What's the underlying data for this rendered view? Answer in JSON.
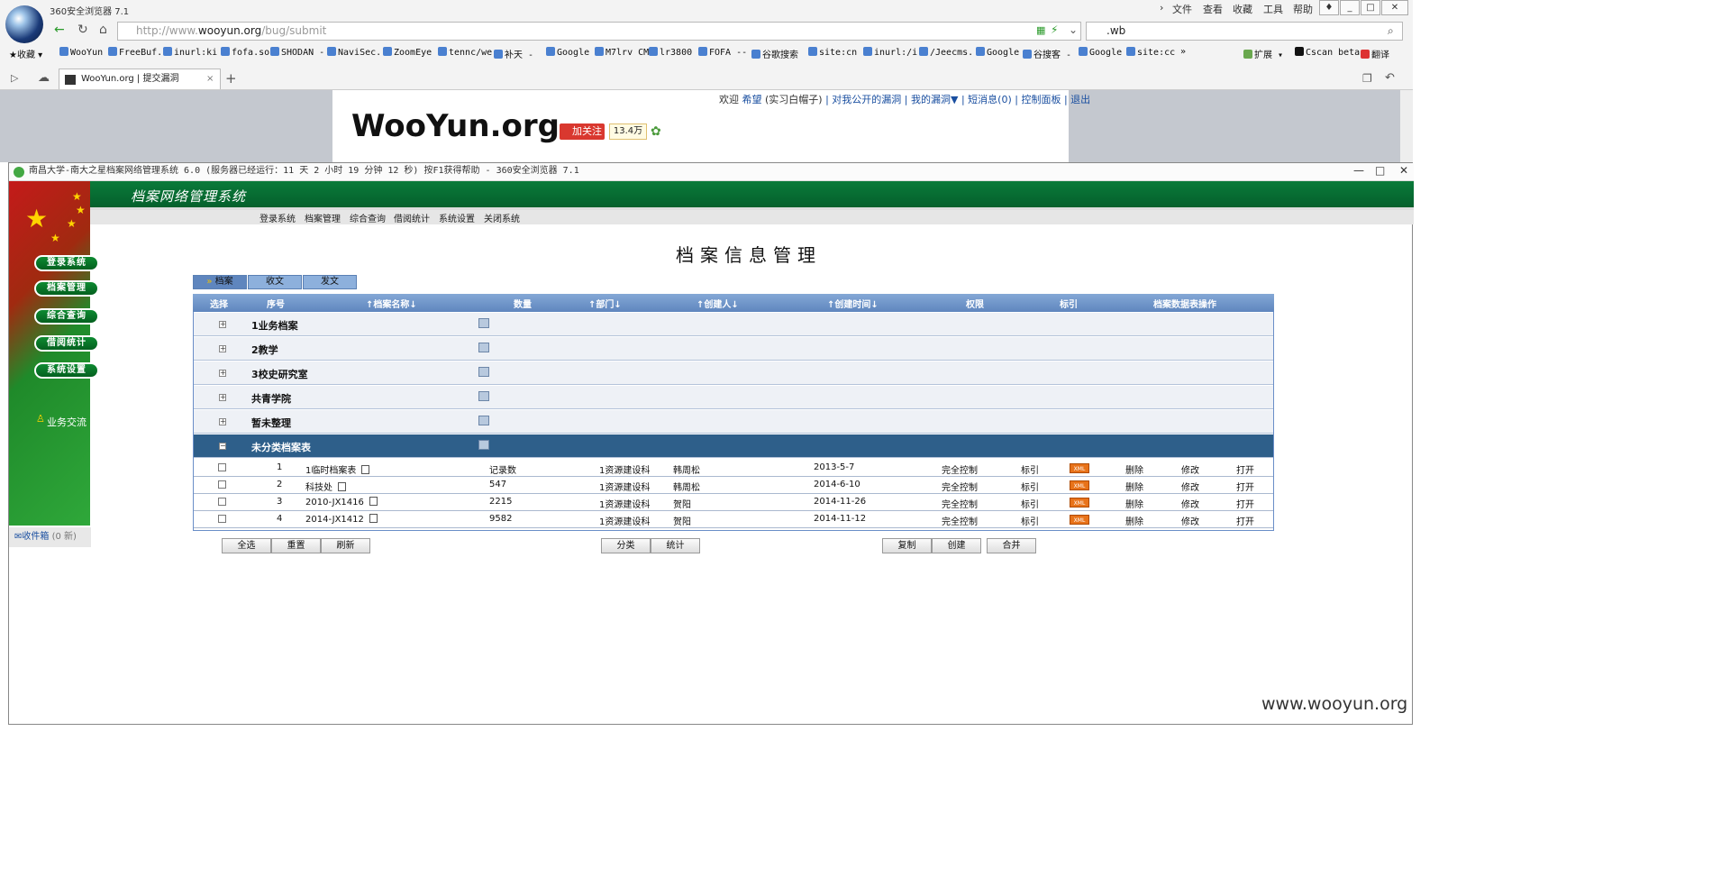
{
  "browser": {
    "title": "360安全浏览器 7.1",
    "menu": [
      "文件",
      "查看",
      "收藏",
      "工具",
      "帮助"
    ],
    "address": {
      "prefix": "http://www.",
      "domain": "wooyun.org",
      "path": "/bug/submit"
    },
    "search_value": ".wb",
    "bookmarks_label": "收藏",
    "bookmarks": [
      "WooYun",
      "FreeBuf.",
      "inurl:ki",
      "fofa.so",
      "SHODAN -",
      "NaviSec.",
      "ZoomEye",
      "tennc/we",
      "补天 -",
      "Google",
      "M7lrv CM",
      "lr3800",
      "FOFA --",
      "谷歌搜索",
      "site:cn",
      "inurl:/i",
      "/Jeecms.",
      "Google",
      "谷搜客 -",
      "Google",
      "site:cc"
    ],
    "bookmarks_more": "»",
    "extensions": [
      "扩展",
      "Cscan beta",
      "翻译"
    ],
    "tab_title": "WooYun.org | 提交漏洞"
  },
  "wooyun": {
    "logo": "WooYun.org",
    "welcome": "欢迎",
    "user": "希望",
    "user_level": "(实习白帽子)",
    "links": [
      "对我公开的漏洞",
      "我的漏洞▼",
      "短消息(0)",
      "控制面板",
      "退出"
    ],
    "follow": "加关注",
    "follow_count": "13.4万"
  },
  "app": {
    "window_title": "南昌大学-南大之星档案网络管理系统 6.0 (服务器已经运行：11 天 2 小时 19 分钟 12 秒) 按F1获得帮助 - 360安全浏览器 7.1",
    "system_title": "档案网络管理系统",
    "top_nav": [
      "登录系统",
      "档案管理",
      "综合查询",
      "借阅统计",
      "系统设置",
      "关闭系统"
    ],
    "side_nav": [
      "登录系统",
      "档案管理",
      "综合查询",
      "借阅统计",
      "系统设置"
    ],
    "biz_exchange": "业务交流",
    "inbox": {
      "label": "收件箱",
      "count": "(0 新)"
    },
    "page_title": "档案信息管理",
    "folder_tabs": [
      "档案",
      "收文",
      "发文"
    ],
    "columns": [
      "选择",
      "序号",
      "↑档案名称↓",
      "数量",
      "↑部门↓",
      "↑创建人↓",
      "↑创建时间↓",
      "权限",
      "标引",
      "档案数据表操作"
    ],
    "groups": [
      {
        "name": "1业务档案",
        "expanded": false
      },
      {
        "name": "2教学",
        "expanded": false
      },
      {
        "name": "3校史研究室",
        "expanded": false
      },
      {
        "name": "共青学院",
        "expanded": false
      },
      {
        "name": "暂未整理",
        "expanded": false
      },
      {
        "name": "未分类档案表",
        "expanded": true
      }
    ],
    "rows": [
      {
        "no": "1",
        "name": "1临时档案表",
        "count": "记录数",
        "dept": "1资源建设科",
        "creator": "韩周松",
        "date": "2013-5-7",
        "perm": "完全控制",
        "index": "标引",
        "xml": "XML",
        "del": "删除",
        "edit": "修改",
        "open": "打开"
      },
      {
        "no": "2",
        "name": "科技处",
        "count": "547",
        "dept": "1资源建设科",
        "creator": "韩周松",
        "date": "2014-6-10",
        "perm": "完全控制",
        "index": "标引",
        "xml": "XML",
        "del": "删除",
        "edit": "修改",
        "open": "打开"
      },
      {
        "no": "3",
        "name": "2010-JX1416",
        "count": "2215",
        "dept": "1资源建设科",
        "creator": "贺阳",
        "date": "2014-11-26",
        "perm": "完全控制",
        "index": "标引",
        "xml": "XML",
        "del": "删除",
        "edit": "修改",
        "open": "打开"
      },
      {
        "no": "4",
        "name": "2014-JX1412",
        "count": "9582",
        "dept": "1资源建设科",
        "creator": "贺阳",
        "date": "2014-11-12",
        "perm": "完全控制",
        "index": "标引",
        "xml": "XML",
        "del": "删除",
        "edit": "修改",
        "open": "打开"
      }
    ],
    "buttons_left": [
      "全选",
      "重置",
      "刷新"
    ],
    "buttons_mid": [
      "分类",
      "统计"
    ],
    "buttons_right": [
      "复制",
      "创建",
      "合并"
    ]
  },
  "watermark": "www.wooyun.org"
}
